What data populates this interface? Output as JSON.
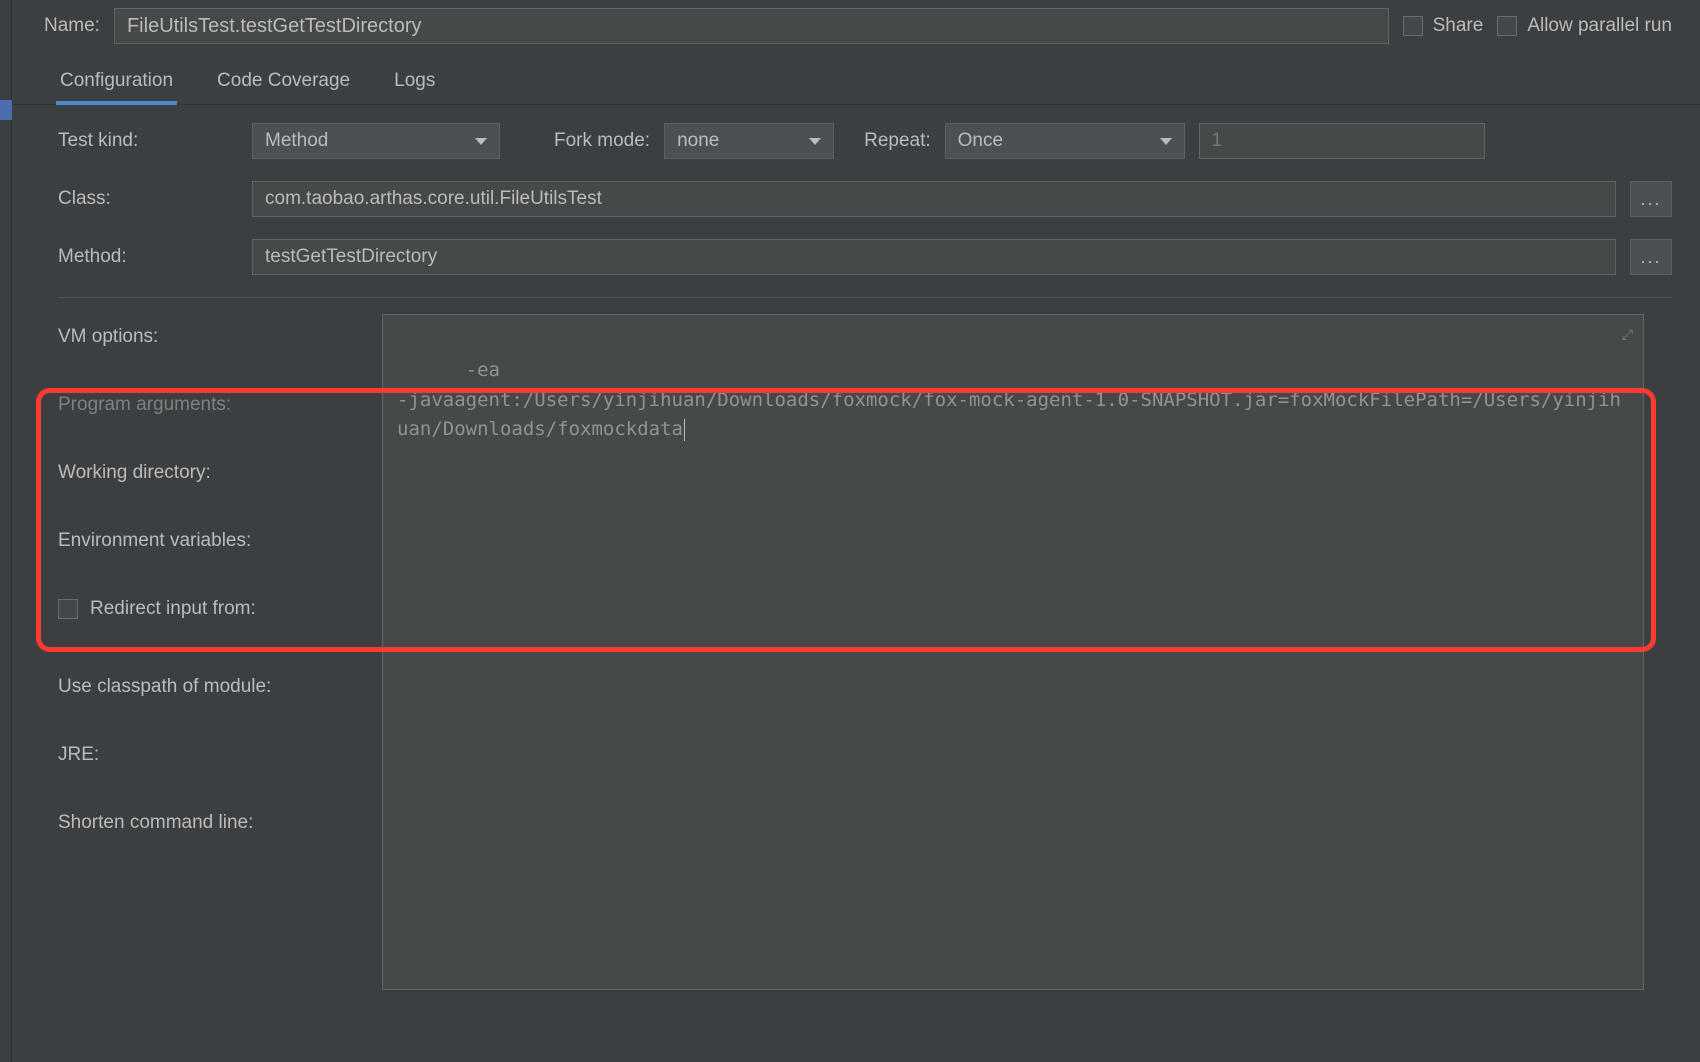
{
  "header": {
    "name_label": "Name:",
    "name_value": "FileUtilsTest.testGetTestDirectory",
    "share_label": "Share",
    "allow_parallel_label": "Allow parallel run"
  },
  "tabs": [
    {
      "label": "Configuration",
      "active": true
    },
    {
      "label": "Code Coverage",
      "active": false
    },
    {
      "label": "Logs",
      "active": false
    }
  ],
  "form": {
    "test_kind_label": "Test kind:",
    "test_kind_value": "Method",
    "fork_mode_label": "Fork mode:",
    "fork_mode_value": "none",
    "repeat_label": "Repeat:",
    "repeat_value": "Once",
    "repeat_count": "1",
    "class_label": "Class:",
    "class_value": "com.taobao.arthas.core.util.FileUtilsTest",
    "method_label": "Method:",
    "method_value": "testGetTestDirectory",
    "browse": "..."
  },
  "lower": {
    "vm_options_label": "VM options:",
    "program_arguments_label": "Program arguments:",
    "working_directory_label": "Working directory:",
    "env_vars_label": "Environment variables:",
    "redirect_label": "Redirect input from:",
    "classpath_label": "Use classpath of module:",
    "jre_label": "JRE:",
    "shorten_label": "Shorten command line:",
    "vm_options_value": "-ea\n-javaagent:/Users/yinjihuan/Downloads/foxmock/fox-mock-agent-1.0-SNAPSHOT.jar=foxMockFilePath=/Users/yinjihuan/Downloads/foxmockdata"
  }
}
